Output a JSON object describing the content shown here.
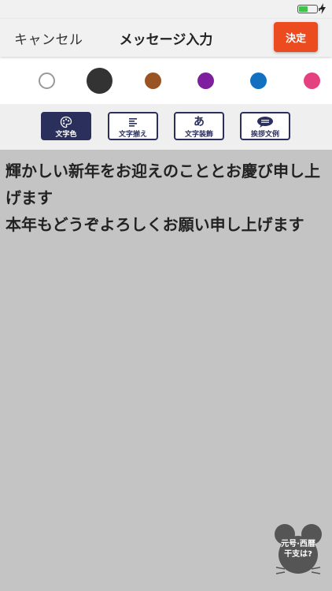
{
  "header": {
    "cancel": "キャンセル",
    "title": "メッセージ入力",
    "done": "決定"
  },
  "status": {
    "battery_level": 0.5
  },
  "colors": {
    "swatches": [
      {
        "name": "white",
        "hex": "#ffffff"
      },
      {
        "name": "black",
        "hex": "#333333",
        "selected": true
      },
      {
        "name": "brown",
        "hex": "#9a5424"
      },
      {
        "name": "purple",
        "hex": "#7d1f9e"
      },
      {
        "name": "blue",
        "hex": "#1370c1"
      },
      {
        "name": "pink",
        "hex": "#e3417f"
      }
    ]
  },
  "tabs": [
    {
      "label": "文字色",
      "icon": "palette-icon",
      "active": true
    },
    {
      "label": "文字揃え",
      "icon": "align-lines-icon",
      "active": false
    },
    {
      "label": "文字装飾",
      "icon": "hiragana-a-icon",
      "active": false
    },
    {
      "label": "挨拶文例",
      "icon": "speech-bubble-icon",
      "active": false
    }
  ],
  "tab_icon_text": {
    "decoration": "あ"
  },
  "message": {
    "lines": [
      "輝かしい新年をお迎えのこととお慶び申し上げます",
      "本年もどうぞよろしくお願い申し上げます"
    ]
  },
  "eto_badge": {
    "line1": "元号·西暦",
    "line2": "干支は?"
  },
  "theme": {
    "accent": "#ec4a1f",
    "navy": "#2b2f5c",
    "bg": "#c4c4c4"
  }
}
